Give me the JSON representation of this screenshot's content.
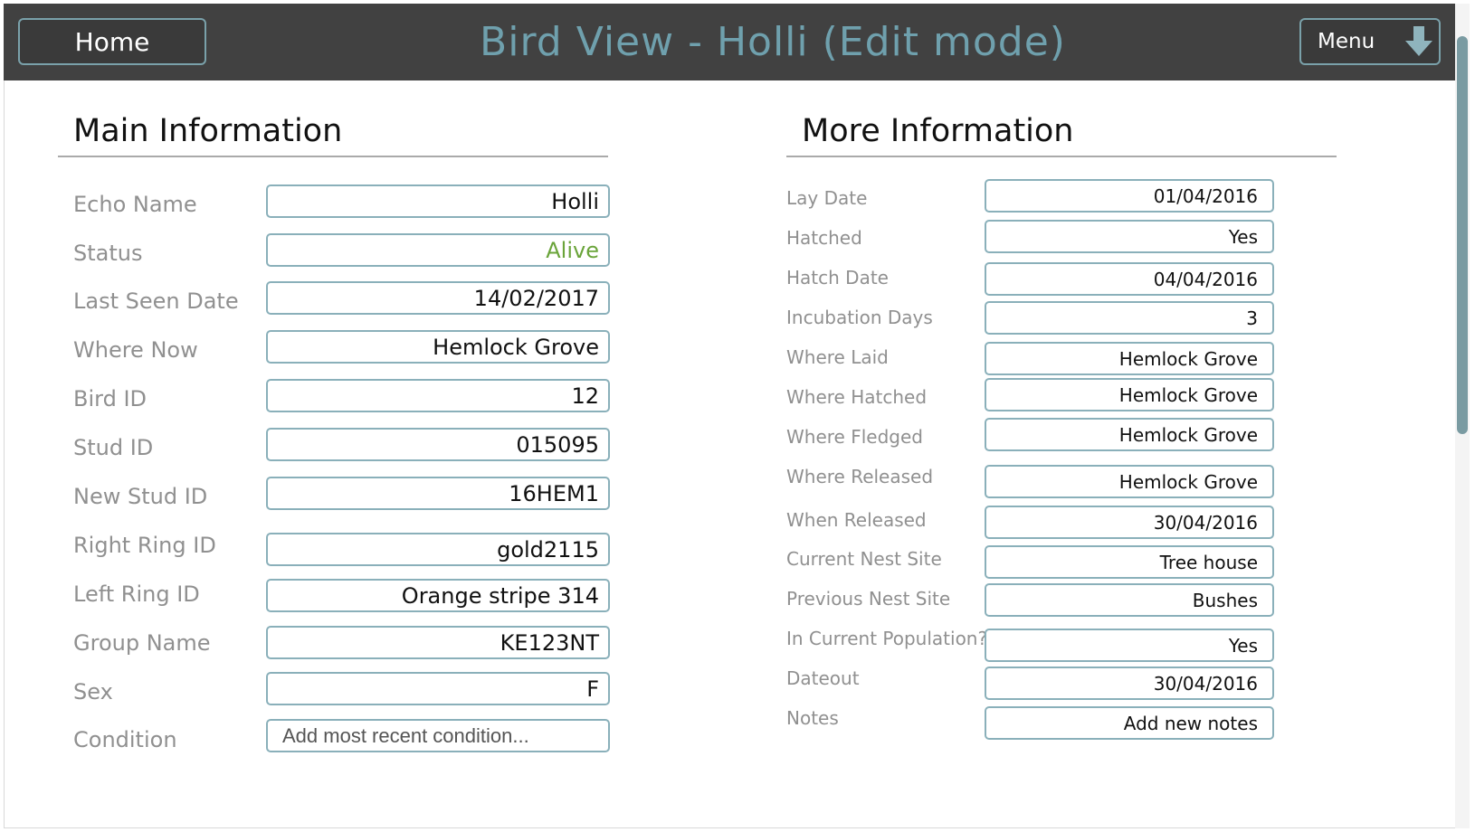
{
  "header": {
    "home_label": "Home",
    "title": "Bird View - Holli (Edit mode)",
    "menu_label": "Menu",
    "menu_icon": "down-arrow-icon"
  },
  "main_info": {
    "title": "Main Information",
    "fields": {
      "echo_name": {
        "label": "Echo Name",
        "value": "Holli"
      },
      "status": {
        "label": "Status",
        "value": "Alive",
        "color": "#6aa43a"
      },
      "last_seen_date": {
        "label": "Last Seen Date",
        "value": "14/02/2017"
      },
      "where_now": {
        "label": "Where Now",
        "value": "Hemlock Grove"
      },
      "bird_id": {
        "label": "Bird ID",
        "value": "12"
      },
      "stud_id": {
        "label": "Stud ID",
        "value": "015095"
      },
      "new_stud_id": {
        "label": "New Stud ID",
        "value": "16HEM1"
      },
      "right_ring_id": {
        "label": "Right Ring ID",
        "value": "gold2115"
      },
      "left_ring_id": {
        "label": "Left Ring ID",
        "value": "Orange stripe 314"
      },
      "group_name": {
        "label": "Group Name",
        "value": "KE123NT"
      },
      "sex": {
        "label": "Sex",
        "value": "F"
      },
      "condition": {
        "label": "Condition",
        "placeholder": "Add most recent condition..."
      }
    }
  },
  "more_info": {
    "title": "More Information",
    "fields": {
      "lay_date": {
        "label": "Lay Date",
        "value": "01/04/2016"
      },
      "hatched": {
        "label": "Hatched",
        "value": "Yes"
      },
      "hatch_date": {
        "label": "Hatch Date",
        "value": "04/04/2016"
      },
      "incubation_days": {
        "label": "Incubation Days",
        "value": "3"
      },
      "where_laid": {
        "label": "Where Laid",
        "value": "Hemlock Grove"
      },
      "where_hatched": {
        "label": "Where Hatched",
        "value": "Hemlock Grove"
      },
      "where_fledged": {
        "label": "Where Fledged",
        "value": "Hemlock Grove"
      },
      "where_released": {
        "label": "Where Released",
        "value": "Hemlock Grove"
      },
      "when_released": {
        "label": "When Released",
        "value": "30/04/2016"
      },
      "current_nest_site": {
        "label": "Current Nest Site",
        "value": "Tree house"
      },
      "previous_nest_site": {
        "label": "Previous Nest Site",
        "value": "Bushes"
      },
      "in_current_population": {
        "label": "In Current Population?",
        "value": "Yes"
      },
      "dateout": {
        "label": "Dateout",
        "value": "30/04/2016"
      },
      "notes": {
        "label": "Notes",
        "value": "Add new notes"
      }
    }
  },
  "colors": {
    "topbar": "#414141",
    "title_accent": "#6fa0ad",
    "field_border": "#8ab0ba",
    "status_alive": "#6aa43a"
  }
}
